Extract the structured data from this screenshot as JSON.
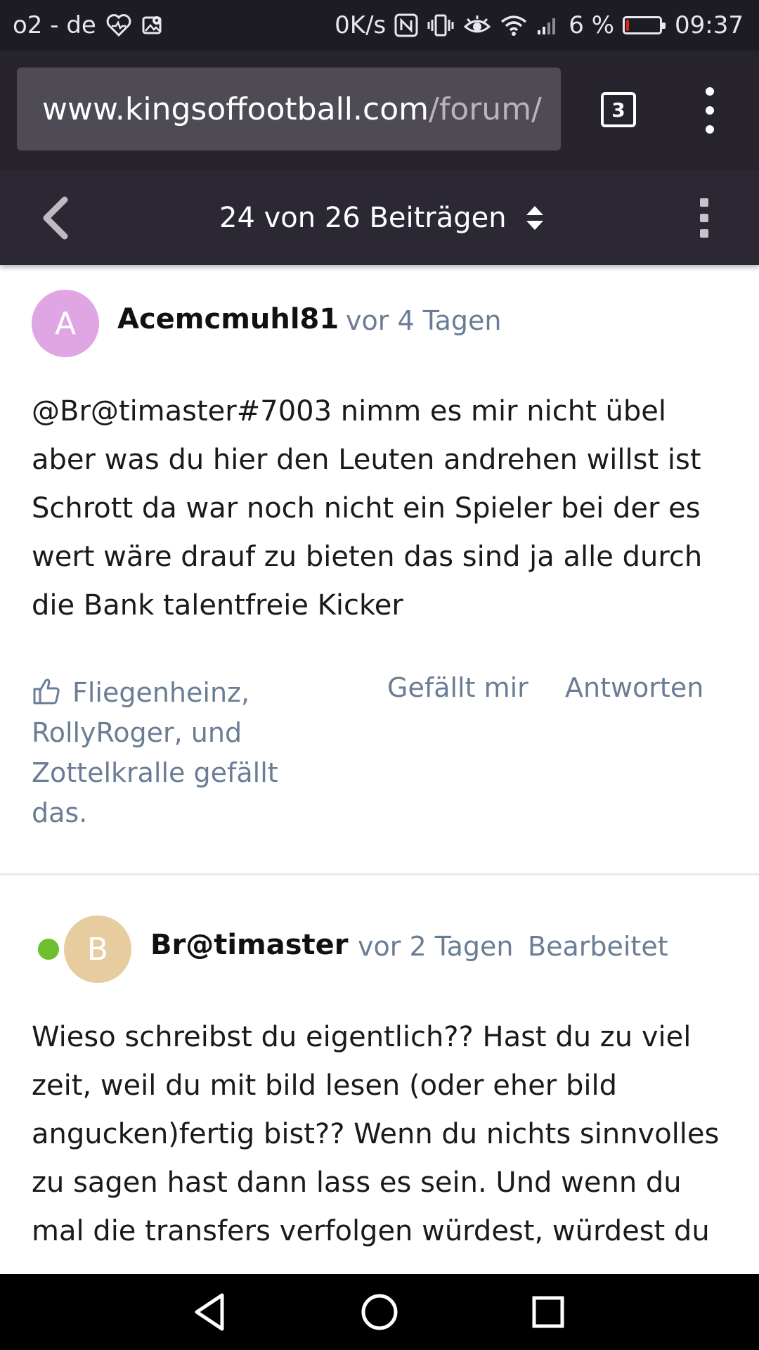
{
  "statusbar": {
    "carrier": "o2 - de",
    "net_speed": "0K/s",
    "battery": "6 %",
    "battery_level": 0.06,
    "time": "09:37"
  },
  "browser": {
    "url_domain": "www.kingsoffootball.com",
    "url_path": "/forum/",
    "tab_count": "3"
  },
  "forum_nav": {
    "post_counter": "24 von 26 Beiträgen"
  },
  "posts": [
    {
      "avatar_letter": "A",
      "avatar_color": "#e0a6e4",
      "author": "Acemcmuhl81",
      "time": "vor 4 Tagen",
      "body": "@Br@timaster#7003 nimm es mir nicht übel aber was du hier den Leuten andrehen willst ist Schrott da war noch nicht ein Spieler bei der es wert wäre drauf zu bieten das sind ja alle durch die Bank talentfreie Kicker",
      "likes": "Fliegenheinz, RollyRoger, und Zottelkralle gefällt das.",
      "like_action": "Gefällt mir",
      "reply_action": "Antworten"
    },
    {
      "avatar_letter": "B",
      "avatar_color": "#e6cc9e",
      "online_color": "#6cbf2d",
      "author": "Br@timaster",
      "time": "vor 2 Tagen",
      "edited": "Bearbeitet",
      "body": "Wieso schreibst du eigentlich?? Hast du zu viel zeit, weil du mit bild lesen (oder eher bild angucken)fertig bist?? Wenn du nichts sinnvolles zu sagen hast dann lass es sein. Und wenn du mal die transfers verfolgen würdest, würdest du"
    }
  ],
  "colors": {
    "chrome_dark": "#27242e",
    "forum_bar": "#2b2833",
    "meta_text": "#6b7d96"
  }
}
